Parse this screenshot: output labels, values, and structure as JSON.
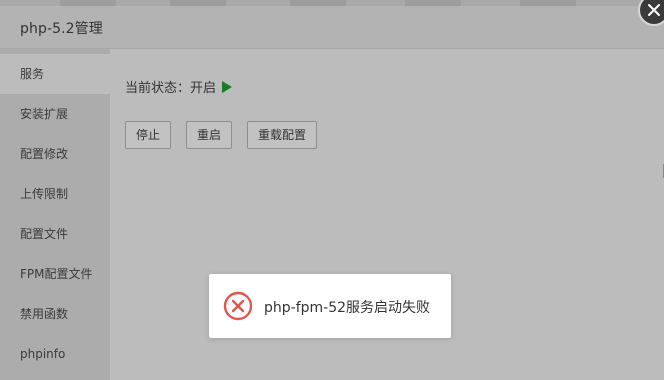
{
  "dialog": {
    "title": "php-5.2管理"
  },
  "sidebar": {
    "items": [
      {
        "label": "服务",
        "active": true
      },
      {
        "label": "安装扩展"
      },
      {
        "label": "配置修改"
      },
      {
        "label": "上传限制"
      },
      {
        "label": "配置文件"
      },
      {
        "label": "FPM配置文件"
      },
      {
        "label": "禁用函数"
      },
      {
        "label": "phpinfo"
      }
    ]
  },
  "service": {
    "status_label": "当前状态：",
    "status_value": "开启",
    "status_icon": "play-icon",
    "status_color": "#1a7a2a"
  },
  "buttons": {
    "stop": "停止",
    "restart": "重启",
    "reload": "重载配置"
  },
  "toast": {
    "message": "php-fpm-52服务启动失败",
    "icon": "error-circle-icon",
    "icon_color": "#e2554f"
  }
}
